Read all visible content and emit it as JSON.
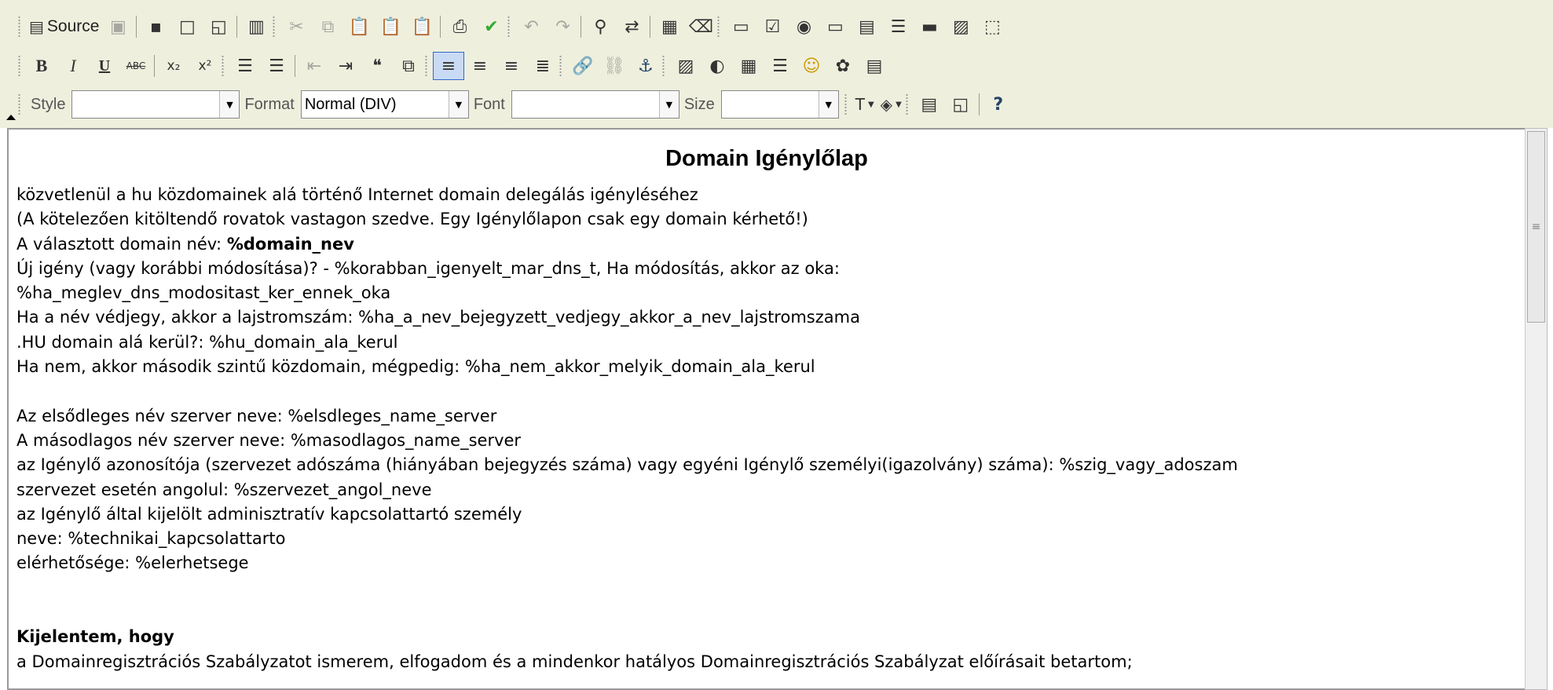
{
  "toolbar": {
    "source_label": "Source",
    "style_label": "Style",
    "style_value": "",
    "format_label": "Format",
    "format_value": "Normal (DIV)",
    "font_label": "Font",
    "font_value": "",
    "size_label": "Size",
    "size_value": ""
  },
  "document": {
    "title": "Domain Igénylőlap",
    "subtitle": "közvetlenül a hu közdomainek alá történő Internet domain delegálás igényléséhez",
    "required_note": "(A kötelezően kitöltendő rovatok vastagon szedve. Egy Igénylőlapon csak egy domain kérhető!)",
    "chosen_domain_label": "A választott domain név: ",
    "chosen_domain_value": "%domain_nev",
    "new_request": "Új igény (vagy korábbi módosítása)? - %korabban_igenyelt_mar_dns_t, Ha módosítás, akkor az oka:",
    "modify_reason": "%ha_meglev_dns_modositast_ker_ennek_oka",
    "trademark": "Ha a név védjegy, akkor a lajstromszám: %ha_a_nev_bejegyzett_vedjegy_akkor_a_nev_lajstromszama",
    "hu_domain": ".HU domain alá kerül?: %hu_domain_ala_kerul",
    "second_level": "Ha nem, akkor második szintű közdomain, mégpedig: %ha_nem_akkor_melyik_domain_ala_kerul",
    "primary_ns": "Az elsődleges név szerver neve: %elsdleges_name_server",
    "secondary_ns": "A másodlagos név szerver neve: %masodlagos_name_server",
    "applicant_id": "az Igénylő azonosítója (szervezet adószáma (hiányában bejegyzés száma) vagy egyéni Igénylő személyi(igazolvány) száma): %szig_vagy_adoszam",
    "org_english": "szervezet esetén angolul: %szervezet_angol_neve",
    "admin_contact": "az Igénylő által kijelölt adminisztratív kapcsolattartó személy",
    "contact_name": "neve: %technikai_kapcsolattarto",
    "contact_reach": "elérhetősége: %elerhetsege",
    "declare_heading": "Kijelentem, hogy",
    "declare_1": "a Domainregisztrációs Szabályzatot ismerem, elfogadom és a mindenkor hatályos Domainregisztrációs Szabályzat előírásait betartom;"
  },
  "colors": {
    "toolbar_bg": "#efefde",
    "active_button": "#c9daf5",
    "active_border": "#316ac5"
  }
}
